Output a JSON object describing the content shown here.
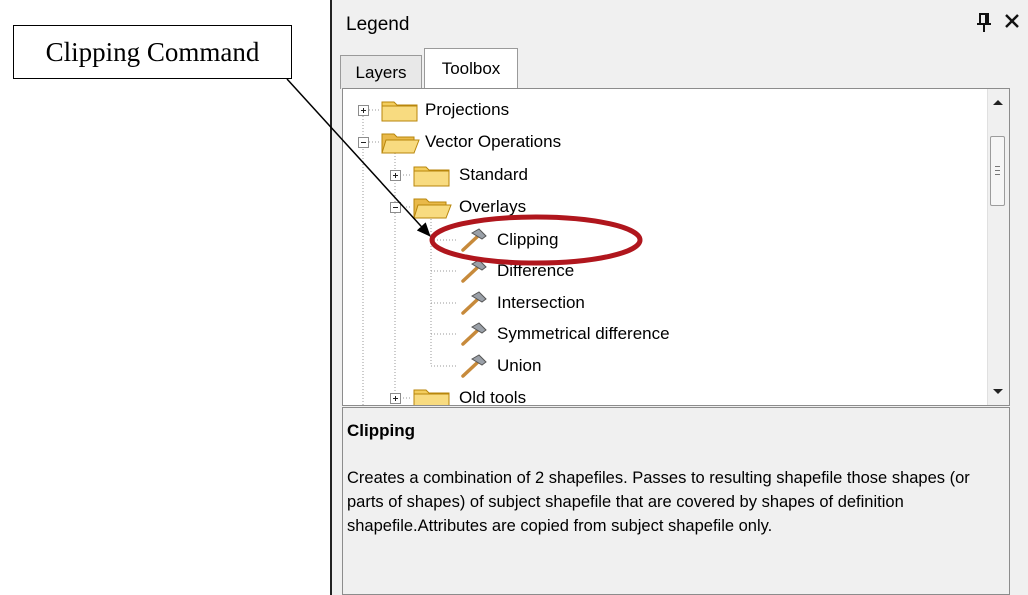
{
  "callout": {
    "text": "Clipping Command"
  },
  "panel": {
    "title": "Legend",
    "pin_glyph": "ᵾ",
    "close_glyph": "×",
    "tabs": [
      {
        "label": "Layers",
        "active": false
      },
      {
        "label": "Toolbox",
        "active": true
      }
    ]
  },
  "tree": {
    "items": [
      {
        "label": "Projections",
        "icon": "folder-closed-icon",
        "expander": "plus"
      },
      {
        "label": "Vector Operations",
        "icon": "folder-open-icon",
        "expander": "minus"
      },
      {
        "label": "Standard",
        "icon": "folder-closed-icon",
        "expander": "plus"
      },
      {
        "label": "Overlays",
        "icon": "folder-open-icon",
        "expander": "minus"
      },
      {
        "label": "Clipping",
        "icon": "hammer-icon",
        "selected_highlight": true
      },
      {
        "label": "Difference",
        "icon": "hammer-icon"
      },
      {
        "label": "Intersection",
        "icon": "hammer-icon"
      },
      {
        "label": "Symmetrical difference",
        "icon": "hammer-icon"
      },
      {
        "label": "Union",
        "icon": "hammer-icon"
      },
      {
        "label": "Old tools",
        "icon": "folder-closed-icon",
        "expander": "plus"
      }
    ]
  },
  "description": {
    "title": "Clipping",
    "text": "Creates a combination of 2 shapefiles. Passes to resulting shapefile those shapes (or parts of shapes) of subject shapefile that are covered by shapes of definition shapefile.Attributes are copied from subject shapefile only."
  },
  "colors": {
    "highlight_ellipse": "#b0161d",
    "folder_fill": "#f3cd5e",
    "folder_edge": "#b8860b",
    "window_bg": "#f0f0f0"
  }
}
